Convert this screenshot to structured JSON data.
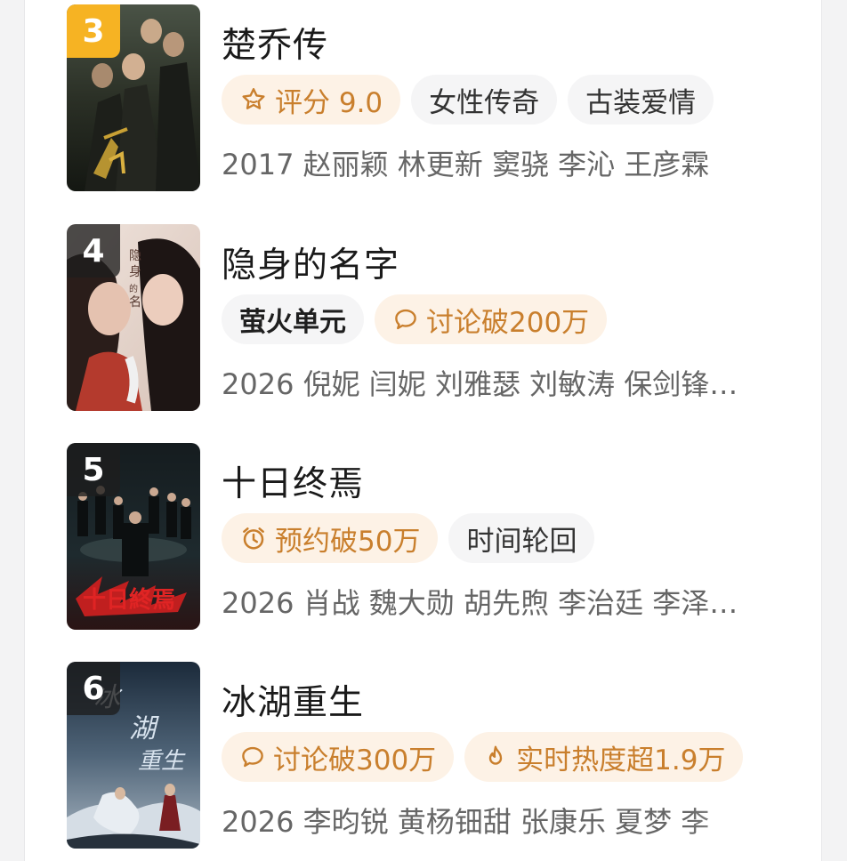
{
  "items": [
    {
      "rank": "3",
      "title": "楚乔传",
      "tags": [
        {
          "icon": "star-icon",
          "text": "评分 9.0",
          "style": "hot"
        },
        {
          "text": "女性传奇",
          "style": "plain"
        },
        {
          "text": "古装爱情",
          "style": "plain"
        }
      ],
      "meta": "2017 赵丽颖 林更新 窦骁 李沁 王彦霖"
    },
    {
      "rank": "4",
      "title": "隐身的名字",
      "tags": [
        {
          "text": "萤火单元",
          "style": "plain"
        },
        {
          "icon": "comment-icon",
          "text": "讨论破200万",
          "style": "hot"
        }
      ],
      "meta": "2026 倪妮 闫妮 刘雅瑟 刘敏涛 保剑锋…"
    },
    {
      "rank": "5",
      "title": "十日终焉",
      "tags": [
        {
          "icon": "alarm-clock-icon",
          "text": "预约破50万",
          "style": "hot"
        },
        {
          "text": "时间轮回",
          "style": "plain"
        }
      ],
      "meta": "2026 肖战 魏大勋 胡先煦 李治廷 李泽…"
    },
    {
      "rank": "6",
      "title": "冰湖重生",
      "tags": [
        {
          "icon": "comment-icon",
          "text": "讨论破300万",
          "style": "hot"
        },
        {
          "icon": "flame-icon",
          "text": "实时热度超1.9万",
          "style": "hot"
        }
      ],
      "meta": "2026 李昀锐 黄杨钿甜 张康乐 夏梦 李"
    }
  ],
  "colors": {
    "rank_gold": "#f6b323",
    "tag_accent_bg": "#fdf2e6",
    "tag_accent_text": "#c97f2d",
    "tag_plain_bg": "#f5f5f6"
  }
}
